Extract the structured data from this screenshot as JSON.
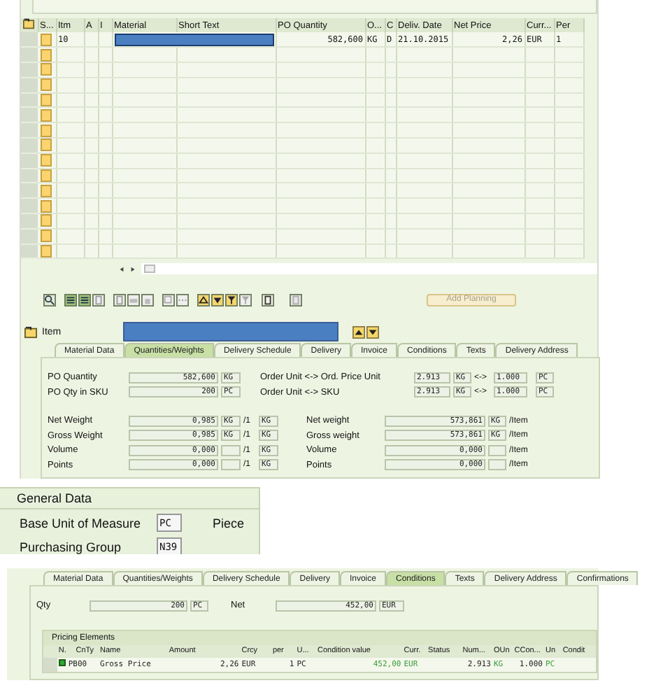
{
  "item_table": {
    "columns": [
      "S...",
      "Itm",
      "A",
      "I",
      "Material",
      "Short Text",
      "PO Quantity",
      "O...",
      "C",
      "Deliv. Date",
      "Net Price",
      "Curr...",
      "Per"
    ],
    "rows": [
      {
        "item": "10",
        "quantity": "582,600",
        "unit": "KG",
        "category": "D",
        "date": "21.10.2015",
        "price": "2,26",
        "currency": "EUR",
        "per": "1"
      }
    ]
  },
  "toolbar": {
    "add_planning": {
      "label": "Add Planning",
      "disabled": true
    }
  },
  "item_header": {
    "label": "Item"
  },
  "item_tabs": [
    {
      "label": "Material Data",
      "selected": false
    },
    {
      "label": "Quantities/Weights",
      "selected": true
    },
    {
      "label": "Delivery Schedule",
      "selected": false
    },
    {
      "label": "Delivery",
      "selected": false
    },
    {
      "label": "Invoice",
      "selected": false
    },
    {
      "label": "Conditions",
      "selected": false
    },
    {
      "label": "Texts",
      "selected": false
    },
    {
      "label": "Delivery Address",
      "selected": false
    }
  ],
  "quantities": [
    {
      "label": "PO Quantity",
      "value": "582,600",
      "unit": "KG",
      "conv_label": "Order Unit <-> Ord. Price Unit",
      "from": "2.913",
      "from_unit": "KG",
      "arrow": "<->",
      "to": "1.000",
      "to_unit": "PC"
    },
    {
      "label": "PO Qty in SKU",
      "value": "200",
      "unit": "PC",
      "conv_label": "Order Unit <-> SKU",
      "from": "2.913",
      "from_unit": "KG",
      "arrow": "<->",
      "to": "1.000",
      "to_unit": "PC"
    }
  ],
  "weights": [
    {
      "label": "Net Weight",
      "value": "0,985",
      "unit": "KG",
      "per": "/1",
      "per_unit": "KG",
      "total_label": "Net weight",
      "total": "573,861",
      "total_unit": "KG",
      "suffix": "/Item"
    },
    {
      "label": "Gross Weight",
      "value": "0,985",
      "unit": "KG",
      "per": "/1",
      "per_unit": "KG",
      "total_label": "Gross weight",
      "total": "573,861",
      "total_unit": "KG",
      "suffix": "/Item"
    },
    {
      "label": "Volume",
      "value": "0,000",
      "per": "/1",
      "per_unit": "KG",
      "total_label": "Volume",
      "total": "0,000",
      "suffix": "/Item"
    },
    {
      "label": "Points",
      "value": "0,000",
      "per": "/1",
      "per_unit": "KG",
      "total_label": "Points",
      "total": "0,000",
      "suffix": "/Item"
    }
  ],
  "general_data": {
    "title": "General Data",
    "rows": [
      {
        "label": "Base Unit of Measure",
        "value": "PC",
        "text": "Piece"
      },
      {
        "label": "Purchasing Group",
        "value": "N39"
      }
    ]
  },
  "conditions_tabs": [
    {
      "label": "Material Data",
      "selected": false
    },
    {
      "label": "Quantities/Weights",
      "selected": false
    },
    {
      "label": "Delivery Schedule",
      "selected": false
    },
    {
      "label": "Delivery",
      "selected": false
    },
    {
      "label": "Invoice",
      "selected": false
    },
    {
      "label": "Conditions",
      "selected": true
    },
    {
      "label": "Texts",
      "selected": false
    },
    {
      "label": "Delivery Address",
      "selected": false
    },
    {
      "label": "Confirmations",
      "selected": false
    }
  ],
  "conditions": {
    "qty_label": "Qty",
    "qty": "200",
    "qty_unit": "PC",
    "net_label": "Net",
    "net": "452,00",
    "net_unit": "EUR"
  },
  "pricing": {
    "title": "Pricing Elements",
    "columns": [
      "N.",
      "CnTy",
      "Name",
      "Amount",
      "Crcy",
      "per",
      "U...",
      "Condition value",
      "Curr.",
      "Status",
      "Num...",
      "OUn",
      "CCon...",
      "Un",
      "Condit"
    ],
    "rows": [
      {
        "type": "PB00",
        "name": "Gross Price",
        "amount": "2,26",
        "currency": "EUR",
        "per": "1",
        "unit": "PC",
        "value": "452,00",
        "value_currency": "EUR",
        "numerator": "2.913",
        "order_unit": "KG",
        "denominator": "1.000",
        "base_unit": "PC"
      }
    ]
  }
}
